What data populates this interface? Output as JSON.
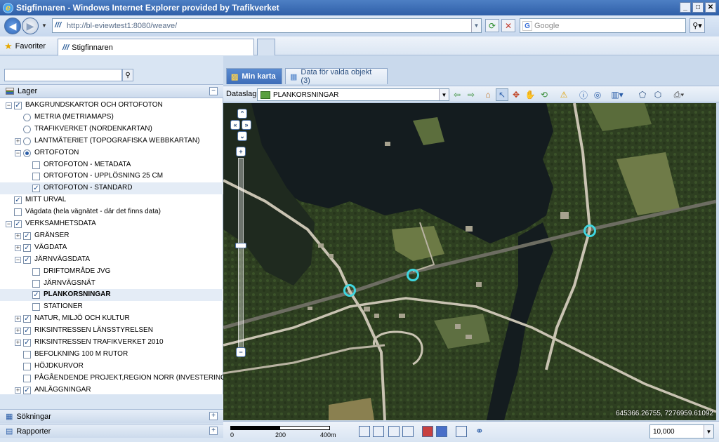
{
  "window": {
    "title": "Stigfinnaren - Windows Internet Explorer provided by Trafikverket"
  },
  "browser": {
    "url": "http://bl-eviewtest1:8080/weave/",
    "search_placeholder": "Google",
    "favorites_label": "Favoriter",
    "tab_label": "Stigfinnaren"
  },
  "left": {
    "lager_title": "Lager",
    "searches_title": "Sökningar",
    "reports_title": "Rapporter",
    "tree": [
      {
        "label": "BAKGRUNDSKARTOR OCH ORTOFOTON",
        "type": "checkbox",
        "checked": true,
        "expander": "-",
        "level": 0
      },
      {
        "label": "METRIA (METRIAMAPS)",
        "type": "radio",
        "checked": false,
        "expander": "",
        "level": 1
      },
      {
        "label": "TRAFIKVERKET (NORDENKARTAN)",
        "type": "radio",
        "checked": false,
        "expander": "",
        "level": 1
      },
      {
        "label": "LANTMÄTERIET (TOPOGRAFISKA WEBBKARTAN)",
        "type": "radio",
        "checked": false,
        "expander": "+",
        "level": 1
      },
      {
        "label": "ORTOFOTON",
        "type": "radio",
        "checked": true,
        "expander": "-",
        "level": 1
      },
      {
        "label": "ORTOFOTON - METADATA",
        "type": "checkbox",
        "checked": false,
        "expander": "",
        "level": 2
      },
      {
        "label": "ORTOFOTON - UPPLÖSNING 25 CM",
        "type": "checkbox",
        "checked": false,
        "expander": "",
        "level": 2
      },
      {
        "label": "ORTOFOTON - STANDARD",
        "type": "checkbox",
        "checked": true,
        "expander": "",
        "level": 2,
        "selected": true
      },
      {
        "label": "MITT URVAL",
        "type": "checkbox",
        "checked": true,
        "expander": "",
        "level": 0
      },
      {
        "label": "Vägdata (hela vägnätet - där det finns data)",
        "type": "checkbox",
        "checked": false,
        "expander": "",
        "level": 0
      },
      {
        "label": "VERKSAMHETSDATA",
        "type": "checkbox",
        "checked": true,
        "expander": "-",
        "level": 0
      },
      {
        "label": "GRÄNSER",
        "type": "checkbox",
        "checked": true,
        "expander": "+",
        "level": 1
      },
      {
        "label": "VÄGDATA",
        "type": "checkbox",
        "checked": true,
        "expander": "+",
        "level": 1
      },
      {
        "label": "JÄRNVÄGSDATA",
        "type": "checkbox",
        "checked": true,
        "expander": "-",
        "level": 1
      },
      {
        "label": "DRIFTOMRÅDE JVG",
        "type": "checkbox",
        "checked": false,
        "expander": "",
        "level": 2
      },
      {
        "label": "JÄRNVÄGSNÄT",
        "type": "checkbox",
        "checked": false,
        "expander": "",
        "level": 2
      },
      {
        "label": "PLANKORSNINGAR",
        "type": "checkbox",
        "checked": true,
        "expander": "",
        "level": 2,
        "selected": true,
        "bold": true
      },
      {
        "label": "STATIONER",
        "type": "checkbox",
        "checked": false,
        "expander": "",
        "level": 2
      },
      {
        "label": "NATUR, MILJÖ OCH KULTUR",
        "type": "checkbox",
        "checked": true,
        "expander": "+",
        "level": 1
      },
      {
        "label": "RIKSINTRESSEN LÄNSSTYRELSEN",
        "type": "checkbox",
        "checked": true,
        "expander": "+",
        "level": 1
      },
      {
        "label": "RIKSINTRESSEN TRAFIKVERKET 2010",
        "type": "checkbox",
        "checked": true,
        "expander": "+",
        "level": 1
      },
      {
        "label": "BEFOLKNING 100 M RUTOR",
        "type": "checkbox",
        "checked": false,
        "expander": "",
        "level": 1
      },
      {
        "label": "HÖJDKURVOR",
        "type": "checkbox",
        "checked": false,
        "expander": "",
        "level": 1
      },
      {
        "label": "PÅGÅENDENDE PROJEKT,REGION NORR (INVESTERING)",
        "type": "checkbox",
        "checked": false,
        "expander": "",
        "level": 1
      },
      {
        "label": "ANLÄGGNINGAR",
        "type": "checkbox",
        "checked": true,
        "expander": "+",
        "level": 1
      }
    ]
  },
  "map": {
    "tabs": {
      "active": "Min karta",
      "inactive": "Data för valda objekt (3)"
    },
    "dataslag_label": "Dataslag",
    "dataslag_value": "PLANKORSNINGAR",
    "coords": "645366.26755, 7276959.61092",
    "scale_value": "10,000",
    "scale_labels": [
      "0",
      "200",
      "400m"
    ],
    "marker_color": "#3fd6e0"
  }
}
